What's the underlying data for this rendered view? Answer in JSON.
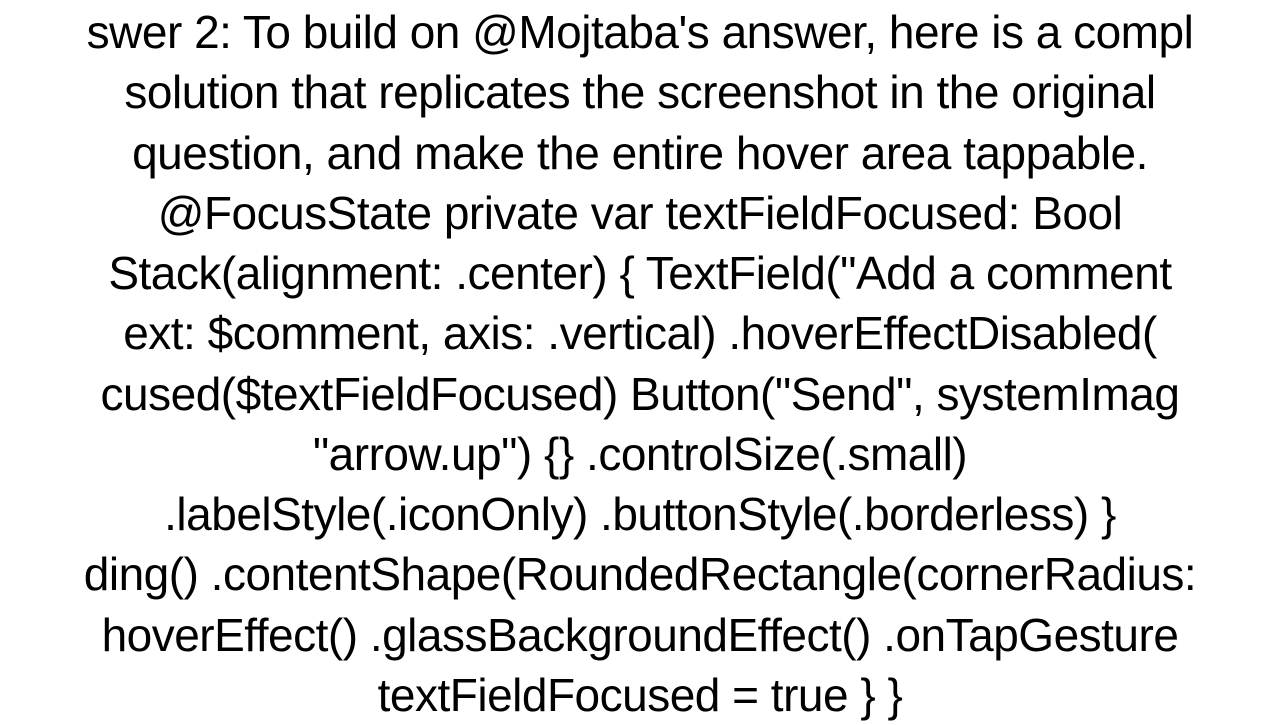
{
  "answer": {
    "intro_line1": "swer 2: To build on @Mojtaba's answer, here is a compl",
    "intro_line2": "solution that replicates the screenshot in the original",
    "intro_line3": "question, and make the entire hover area tappable.",
    "code_line1": "@FocusState private var textFieldFocused: Bool",
    "code_line2": "Stack(alignment: .center) {   TextField(\"Add a comment",
    "code_line3": "ext: $comment, axis: .vertical)     .hoverEffectDisabled(",
    "code_line4": "cused($textFieldFocused)   Button(\"Send\", systemImag",
    "code_line5": "\"arrow.up\") {}     .controlSize(.small)",
    "code_line6": ".labelStyle(.iconOnly)     .buttonStyle(.borderless) }",
    "code_line7": "ding() .contentShape(RoundedRectangle(cornerRadius:",
    "code_line8": "hoverEffect() .glassBackgroundEffect() .onTapGesture ",
    "code_line9": "textFieldFocused = true   } }"
  }
}
